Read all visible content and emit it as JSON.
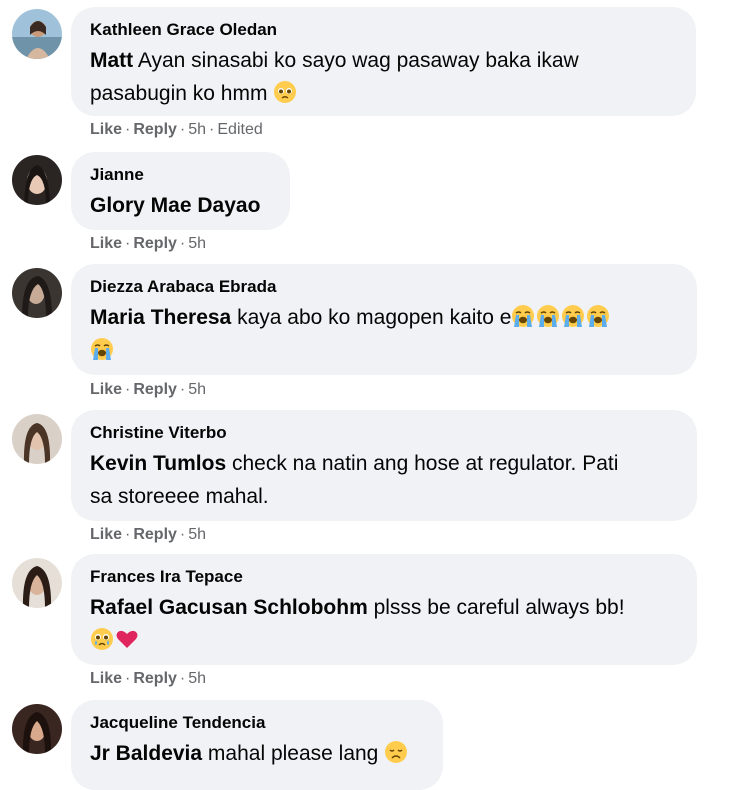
{
  "comments": [
    {
      "author": "Kathleen Grace Oledan",
      "mention": "Matt",
      "text_line1": " Ayan sinasabi ko sayo wag pasaway baka ikaw",
      "text_line2": "pasabugin ko hmm",
      "emojis": [
        "pleading-face-emoji"
      ],
      "like": "Like",
      "reply": "Reply",
      "time": "5h",
      "edited": "Edited"
    },
    {
      "author": "Jianne",
      "mention": "Glory Mae Dayao",
      "like": "Like",
      "reply": "Reply",
      "time": "5h"
    },
    {
      "author": "Diezza Arabaca Ebrada",
      "mention": "Maria Theresa",
      "text": " kaya abo ko magopen kaito e",
      "emojis": [
        "loudly-crying-face-emoji",
        "loudly-crying-face-emoji",
        "loudly-crying-face-emoji",
        "loudly-crying-face-emoji",
        "loudly-crying-face-emoji"
      ],
      "like": "Like",
      "reply": "Reply",
      "time": "5h"
    },
    {
      "author": "Christine Viterbo",
      "mention": "Kevin Tumlos",
      "text_line1": " check na natin ang hose at regulator. Pati",
      "text_line2": "sa storeeee mahal.",
      "like": "Like",
      "reply": "Reply",
      "time": "5h"
    },
    {
      "author": "Frances Ira Tepace",
      "mention": "Rafael Gacusan Schlobohm",
      "text": " plsss be careful always bb!",
      "emojis": [
        "crying-face-emoji",
        "red-heart-emoji"
      ],
      "like": "Like",
      "reply": "Reply",
      "time": "5h"
    },
    {
      "author": "Jacqueline Tendencia",
      "mention": "Jr Baldevia",
      "text": " mahal please lang",
      "emojis": [
        "disappointed-face-emoji"
      ]
    }
  ],
  "colors": {
    "bubble": "#f0f2f5",
    "meta": "#65676b",
    "text": "#050505",
    "emoji_yellow": "#ffcc4d",
    "heart": "#e0245e",
    "tear": "#5dadec"
  }
}
